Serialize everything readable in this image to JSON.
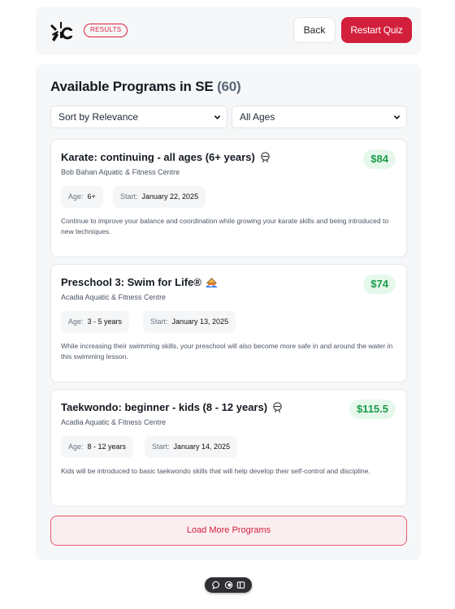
{
  "header": {
    "badge": "RESULTS",
    "back_label": "Back",
    "restart_label": "Restart Quiz"
  },
  "programs_section": {
    "heading": "Available Programs in SE",
    "count": "(60)",
    "sort": {
      "selected": "Sort by Relevance"
    },
    "ages": {
      "selected": "All Ages"
    },
    "load_more_label": "Load More Programs"
  },
  "programs": [
    {
      "title": "Karate: continuing - all ages (6+ years)",
      "icon": "martial-arts-icon",
      "provider": "Bob Bahan Aquatic & Fitness Centre",
      "price": "$84",
      "age_label": "Age:",
      "age": "6+",
      "start_label": "Start:",
      "start": "January 22, 2025",
      "description": "Continue to improve your balance and coordination while growing your karate skills and being introduced to new techniques."
    },
    {
      "title": "Preschool 3: Swim for Life®",
      "icon": "swimming-icon",
      "provider": "Acadia Aquatic & Fitness Centre",
      "price": "$74",
      "age_label": "Age:",
      "age": "3 - 5 years",
      "start_label": "Start:",
      "start": "January 13, 2025",
      "description": "While increasing their swimming skills, your preschool will also become more safe in and around the water in this swimming lesson."
    },
    {
      "title": "Taekwondo: beginner - kids (8 - 12 years)",
      "icon": "martial-arts-icon",
      "provider": "Acadia Aquatic & Fitness Centre",
      "price": "$115.5",
      "age_label": "Age:",
      "age": "8 - 12 years",
      "start_label": "Start:",
      "start": "January 14, 2025",
      "description": "Kids will be introduced to basic taekwondo skills that will help develop their self-control and discipline."
    }
  ],
  "toolbar": {
    "icons": [
      "chat-icon",
      "toggle-icon",
      "panel-icon"
    ]
  },
  "colors": {
    "brand_red": "#d21f3c",
    "price_green": "#1a9c4a",
    "price_bg": "#e6f8ec",
    "card_bg": "#f6f7f8"
  }
}
